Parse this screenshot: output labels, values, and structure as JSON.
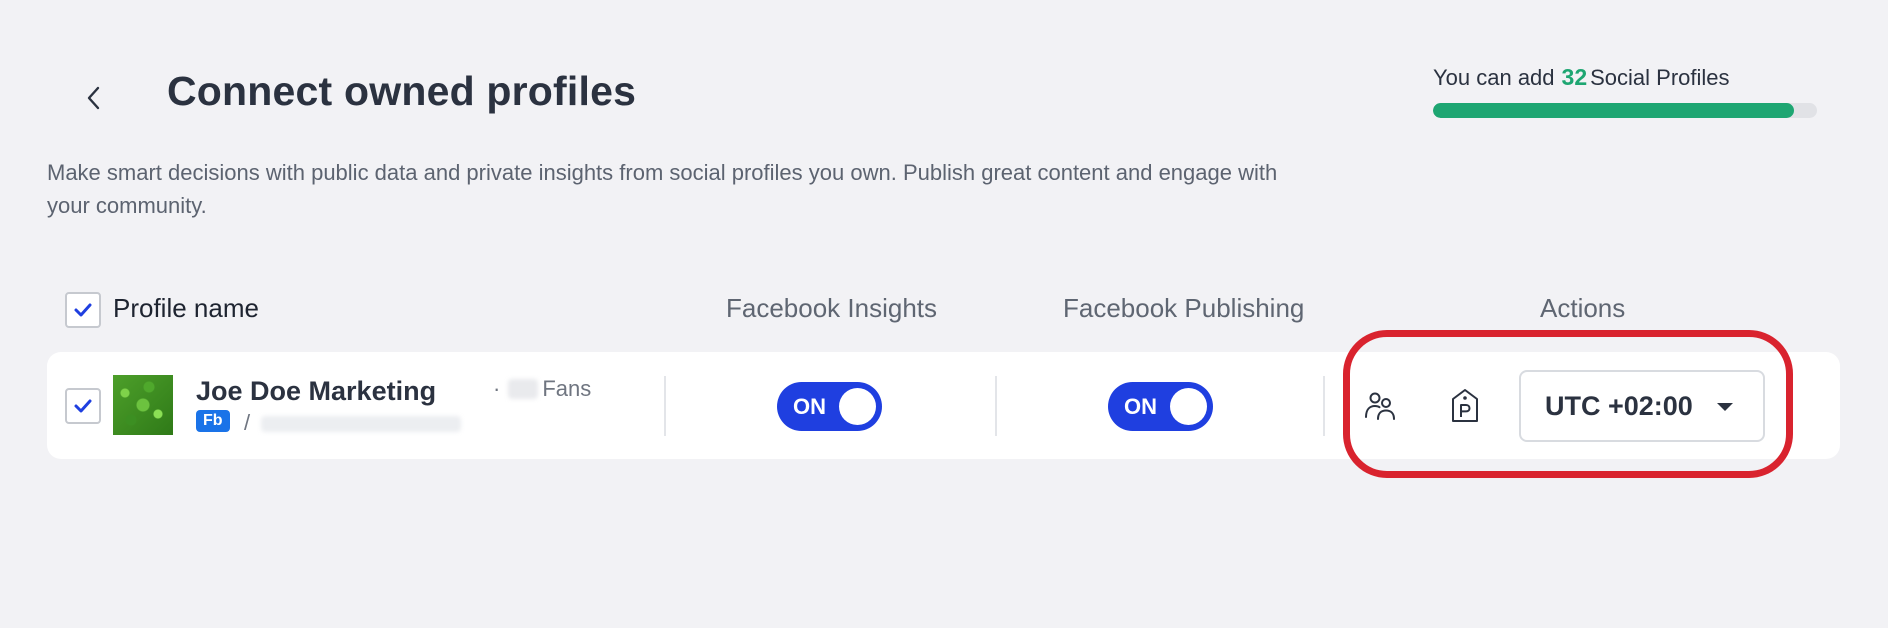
{
  "header": {
    "title": "Connect owned profiles",
    "description": "Make smart decisions with public data and private insights from social profiles you own. Publish great content and engage with your community.",
    "back_icon": "chevron-left-icon"
  },
  "quota": {
    "prefix": "You can add",
    "count": "32",
    "suffix": "Social Profiles",
    "progress_fraction": 0.94,
    "color": "#1ea672"
  },
  "table": {
    "headers": {
      "profile_name": "Profile name",
      "insights": "Facebook Insights",
      "publishing": "Facebook Publishing",
      "actions": "Actions"
    },
    "rows": [
      {
        "name": "Joe Doe Marketing",
        "fans_label": "Fans",
        "network_badge": "Fb",
        "url_prefix": "/",
        "insights_toggle": "ON",
        "publishing_toggle": "ON",
        "timezone": "UTC +02:00",
        "actions_icons": [
          "users-icon",
          "tag-p-icon"
        ]
      }
    ]
  },
  "colors": {
    "accent_toggle": "#1f3fe0",
    "badge": "#1a73e8",
    "highlight": "#d9232e"
  }
}
